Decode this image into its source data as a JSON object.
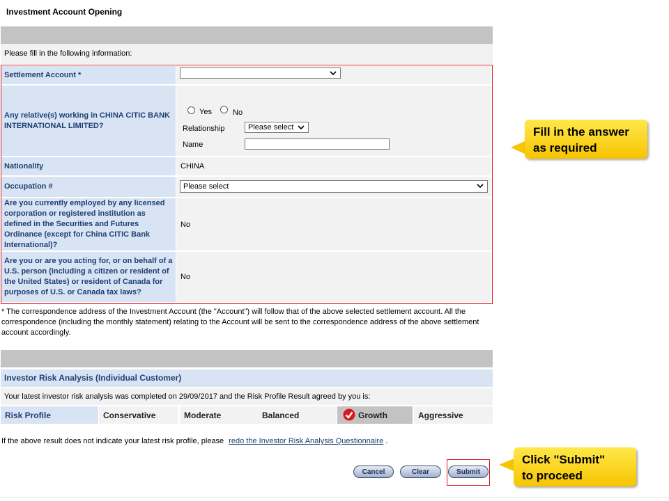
{
  "page": {
    "title": "Investment Account Opening"
  },
  "form": {
    "intro": "Please fill in the following information:",
    "settlement_account": {
      "label": "Settlement Account *",
      "value": ""
    },
    "relatives": {
      "label": "Any relative(s) working in CHINA CITIC BANK INTERNATIONAL LIMITED?",
      "yes_label": "Yes",
      "no_label": "No",
      "relationship_label": "Relationship",
      "relationship_value": "Please select",
      "name_label": "Name",
      "name_value": ""
    },
    "nationality": {
      "label": "Nationality",
      "value": "CHINA"
    },
    "occupation": {
      "label": "Occupation #",
      "value": "Please select"
    },
    "employed": {
      "label": "Are you currently employed by any licensed corporation or registered institution as defined in the Securities and Futures Ordinance (except for China CITIC Bank International)?",
      "value": "No"
    },
    "us_person": {
      "label": "Are you or are you acting for, or on behalf of a U.S. person (including a citizen or resident of the United States) or resident of Canada for purposes of U.S. or Canada tax laws?",
      "value": "No"
    }
  },
  "note": "* The correspondence address of the Investment Account (the \"Account\") will follow that of the above selected settlement account. All the correspondence (including the monthly statement) relating to the Account will be sent to the correspondence address of the above settlement account accordingly.",
  "risk": {
    "heading": "Investor Risk Analysis (Individual Customer)",
    "latest": "Your latest investor risk analysis was completed on 29/09/2017 and the Risk Profile Result agreed by you is:",
    "profile_label": "Risk Profile",
    "levels": [
      "Conservative",
      "Moderate",
      "Balanced",
      "Growth",
      "Aggressive"
    ],
    "selected": "Growth",
    "redo_prefix": "If the above result does not indicate your latest risk profile, please",
    "redo_link": "redo the Investor Risk Analysis Questionnaire",
    "redo_suffix": "."
  },
  "buttons": {
    "cancel": "Cancel",
    "clear": "Clear",
    "submit": "Submit"
  },
  "callouts": {
    "fill": [
      "Fill in the answer",
      "as required"
    ],
    "submit": [
      "Click \"Submit\"",
      "to proceed"
    ]
  },
  "colors": {
    "accent_red": "#d9181f",
    "label_blue": "#1f3e73",
    "callout_yellow": "#f7c400"
  }
}
